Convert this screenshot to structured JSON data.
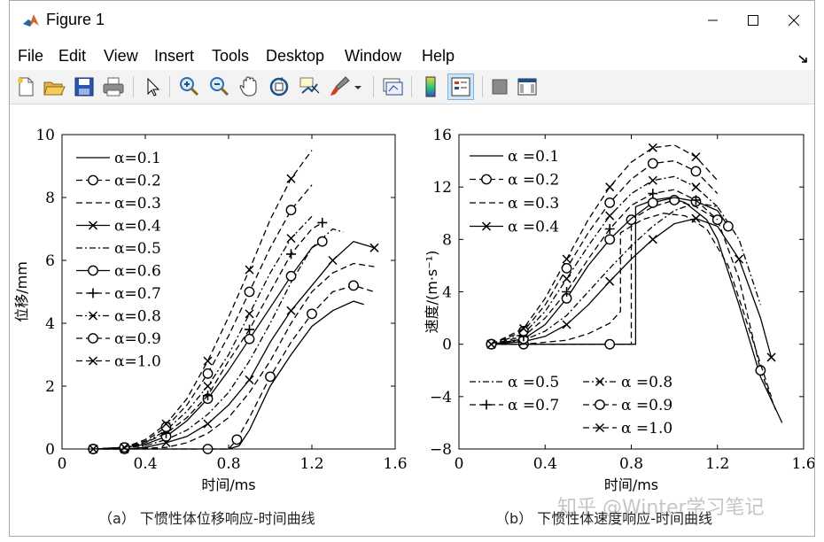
{
  "window": {
    "title": "Figure 1",
    "icons": [
      "matlab-icon",
      "minimize-icon",
      "maximize-icon",
      "close-icon",
      "dock-arrow-icon"
    ]
  },
  "menu": [
    "File",
    "Edit",
    "View",
    "Insert",
    "Tools",
    "Desktop",
    "Window",
    "Help"
  ],
  "toolbar": [
    "new-figure-icon",
    "open-file-icon",
    "save-icon",
    "print-icon",
    "select-arrow-icon",
    "zoom-in-icon",
    "zoom-out-icon",
    "pan-hand-icon",
    "rotate-3d-icon",
    "data-cursor-icon",
    "brush-icon",
    "brush-dropdown-icon",
    "link-plot-icon",
    "colorbar-icon",
    "legend-icon",
    "hide-plot-tools-icon",
    "show-plot-tools-icon"
  ],
  "colors": {
    "line": "#000000",
    "active_tool": "#cce4f7"
  },
  "chart_data": [
    {
      "type": "line",
      "caption": "（a） 下惯性体位移响应-时间曲线",
      "ylabel": "位移/mm",
      "xlabel": "时间/ms",
      "xlim": [
        0,
        1.6
      ],
      "ylim": [
        0,
        10
      ],
      "xticks": [
        0,
        0.4,
        0.8,
        1.2,
        1.6
      ],
      "xtick_labels": [
        "0",
        "0.4",
        "0.8",
        "1.2",
        "1.6"
      ],
      "yticks": [
        0,
        2,
        4,
        6,
        8,
        10
      ],
      "ytick_labels": [
        "0",
        "2",
        "4",
        "6",
        "8",
        "10"
      ],
      "legend_position": "top-left",
      "series": [
        {
          "name": "α=0.1",
          "style": "solid",
          "marker": "none",
          "x": [
            0.15,
            0.3,
            0.5,
            0.7,
            0.8,
            0.85,
            0.9,
            1.0,
            1.1,
            1.2,
            1.3,
            1.4,
            1.45
          ],
          "y": [
            0,
            0,
            0,
            0,
            0,
            0.1,
            0.6,
            2.0,
            3.0,
            3.9,
            4.4,
            4.7,
            4.6
          ]
        },
        {
          "name": "α=0.2",
          "style": "dashed",
          "marker": "o",
          "x": [
            0.15,
            0.3,
            0.5,
            0.7,
            0.8,
            0.84,
            0.9,
            1.0,
            1.1,
            1.2,
            1.3,
            1.4,
            1.5
          ],
          "y": [
            0,
            0,
            0,
            0,
            0,
            0.3,
            1.0,
            2.3,
            3.4,
            4.3,
            5.0,
            5.2,
            5.0
          ]
        },
        {
          "name": "α=0.3",
          "style": "dashed",
          "marker": "none",
          "x": [
            0.15,
            0.3,
            0.5,
            0.6,
            0.7,
            0.8,
            0.9,
            1.0,
            1.1,
            1.2,
            1.3,
            1.4,
            1.5
          ],
          "y": [
            0,
            0,
            0.05,
            0.2,
            0.5,
            1.0,
            1.8,
            2.8,
            4.0,
            5.0,
            5.6,
            5.9,
            5.8
          ]
        },
        {
          "name": "α=0.4",
          "style": "solid",
          "marker": "x",
          "x": [
            0.15,
            0.3,
            0.4,
            0.5,
            0.6,
            0.7,
            0.8,
            0.9,
            1.0,
            1.1,
            1.2,
            1.3,
            1.4,
            1.5
          ],
          "y": [
            0,
            0,
            0.05,
            0.2,
            0.4,
            0.8,
            1.4,
            2.2,
            3.4,
            4.4,
            5.2,
            6.0,
            6.6,
            6.4
          ]
        },
        {
          "name": "α=0.5",
          "style": "dashdot",
          "marker": "none",
          "x": [
            0.15,
            0.3,
            0.4,
            0.5,
            0.6,
            0.7,
            0.8,
            0.9,
            1.0,
            1.1,
            1.2,
            1.3,
            1.35
          ],
          "y": [
            0,
            0.05,
            0.1,
            0.3,
            0.6,
            1.1,
            1.8,
            2.8,
            4.0,
            5.3,
            6.4,
            7.0,
            6.9
          ]
        },
        {
          "name": "α=0.6",
          "style": "solid",
          "marker": "o",
          "x": [
            0.15,
            0.3,
            0.4,
            0.5,
            0.6,
            0.7,
            0.8,
            0.9,
            1.0,
            1.1,
            1.2,
            1.25
          ],
          "y": [
            0,
            0.05,
            0.15,
            0.4,
            0.9,
            1.6,
            2.5,
            3.5,
            4.5,
            5.5,
            6.4,
            6.6
          ]
        },
        {
          "name": "α=0.7",
          "style": "dashed",
          "marker": "+",
          "x": [
            0.15,
            0.3,
            0.4,
            0.5,
            0.6,
            0.7,
            0.8,
            0.9,
            1.0,
            1.1,
            1.2,
            1.25
          ],
          "y": [
            0,
            0.05,
            0.2,
            0.5,
            1.0,
            1.7,
            2.8,
            3.8,
            5.0,
            6.2,
            7.0,
            7.2
          ]
        },
        {
          "name": "α=0.8",
          "style": "dashdot",
          "marker": "x",
          "x": [
            0.15,
            0.3,
            0.4,
            0.5,
            0.6,
            0.7,
            0.8,
            0.9,
            1.0,
            1.1,
            1.2
          ],
          "y": [
            0,
            0.05,
            0.2,
            0.6,
            1.2,
            2.0,
            3.0,
            4.3,
            5.6,
            6.7,
            7.4
          ]
        },
        {
          "name": "α=0.9",
          "style": "dashed",
          "marker": "o",
          "x": [
            0.15,
            0.3,
            0.4,
            0.5,
            0.6,
            0.7,
            0.8,
            0.9,
            1.0,
            1.1,
            1.2
          ],
          "y": [
            0,
            0.05,
            0.25,
            0.7,
            1.4,
            2.4,
            3.6,
            5.0,
            6.4,
            7.6,
            8.4
          ]
        },
        {
          "name": "α=1.0",
          "style": "dashed",
          "marker": "x",
          "x": [
            0.15,
            0.3,
            0.4,
            0.5,
            0.6,
            0.7,
            0.8,
            0.9,
            1.0,
            1.1,
            1.2
          ],
          "y": [
            0,
            0.05,
            0.3,
            0.8,
            1.6,
            2.8,
            4.2,
            5.7,
            7.3,
            8.6,
            9.5
          ]
        }
      ]
    },
    {
      "type": "line",
      "caption": "（b） 下惯性体速度响应-时间曲线",
      "ylabel": "速度/(m·s⁻¹)",
      "xlabel": "时间/ms",
      "xlim": [
        0,
        1.6
      ],
      "ylim": [
        -8,
        16
      ],
      "xticks": [
        0,
        0.4,
        0.8,
        1.2,
        1.6
      ],
      "xtick_labels": [
        "0",
        "0.4",
        "0.8",
        "1.2",
        "1.6"
      ],
      "yticks": [
        -8,
        -4,
        0,
        4,
        8,
        12,
        16
      ],
      "ytick_labels": [
        "−8",
        "−4",
        "0",
        "4",
        "8",
        "12",
        "16"
      ],
      "legend_position": "top-left and bottom-left",
      "series": [
        {
          "name": "α =0.1",
          "style": "solid",
          "marker": "none",
          "x": [
            0.15,
            0.3,
            0.5,
            0.7,
            0.82,
            0.82,
            0.9,
            0.98,
            1.05,
            1.15,
            1.2,
            1.3,
            1.4,
            1.5
          ],
          "y": [
            0,
            0,
            0,
            0,
            0,
            10.5,
            11.0,
            11.2,
            10.8,
            9.5,
            8.0,
            3.0,
            -2.5,
            -6.0
          ]
        },
        {
          "name": "α =0.2",
          "style": "dashed",
          "marker": "o",
          "x": [
            0.15,
            0.3,
            0.5,
            0.7,
            0.8,
            0.8,
            0.9,
            1.0,
            1.1,
            1.2,
            1.3,
            1.4,
            1.47
          ],
          "y": [
            0,
            0,
            0,
            0,
            0,
            9.5,
            10.5,
            11.0,
            10.5,
            9.5,
            5.0,
            -2.0,
            -5.0
          ]
        },
        {
          "name": "α =0.3",
          "style": "dashed",
          "marker": "none",
          "x": [
            0.15,
            0.3,
            0.5,
            0.6,
            0.7,
            0.75,
            0.75,
            0.85,
            0.95,
            1.05,
            1.15,
            1.25,
            1.35,
            1.45
          ],
          "y": [
            0,
            0,
            0.3,
            0.8,
            1.6,
            2.5,
            8.5,
            9.5,
            10.0,
            9.8,
            8.8,
            6.0,
            1.0,
            -4.0
          ]
        },
        {
          "name": "α =0.4",
          "style": "solid",
          "marker": "x",
          "x": [
            0.15,
            0.3,
            0.4,
            0.5,
            0.6,
            0.7,
            0.8,
            0.9,
            1.0,
            1.1,
            1.2,
            1.3,
            1.4,
            1.45
          ],
          "y": [
            0,
            0.2,
            0.6,
            1.5,
            3.0,
            4.8,
            6.5,
            8.0,
            9.2,
            9.6,
            9.0,
            6.5,
            2.0,
            -1.0
          ]
        },
        {
          "name": "α =0.5",
          "style": "dashdot",
          "marker": "none",
          "x": [
            0.15,
            0.3,
            0.4,
            0.5,
            0.6,
            0.7,
            0.8,
            0.9,
            1.0,
            1.1,
            1.2,
            1.3,
            1.4
          ],
          "y": [
            0,
            0.3,
            1.0,
            2.2,
            4.0,
            5.8,
            7.5,
            9.0,
            10.2,
            10.8,
            10.5,
            8.0,
            3.0
          ]
        },
        {
          "name": "α =0.6",
          "style": "solid",
          "marker": "o",
          "x": [
            0.15,
            0.3,
            0.4,
            0.5,
            0.6,
            0.7,
            0.8,
            0.9,
            1.0,
            1.1,
            1.2,
            1.25
          ],
          "y": [
            0,
            0.4,
            1.5,
            3.5,
            6.0,
            8.0,
            9.6,
            10.8,
            11.2,
            10.9,
            10.2,
            9.0
          ]
        },
        {
          "name": "α =0.7",
          "style": "dashed",
          "marker": "+",
          "x": [
            0.15,
            0.3,
            0.4,
            0.5,
            0.6,
            0.7,
            0.8,
            0.9,
            1.0,
            1.1,
            1.2
          ],
          "y": [
            0,
            0.6,
            2.0,
            4.0,
            6.5,
            8.8,
            10.6,
            11.5,
            11.8,
            11.0,
            9.5
          ]
        },
        {
          "name": "α =0.8",
          "style": "dashdot",
          "marker": "x",
          "x": [
            0.15,
            0.3,
            0.4,
            0.5,
            0.6,
            0.7,
            0.8,
            0.9,
            1.0,
            1.1,
            1.2
          ],
          "y": [
            0,
            0.8,
            2.5,
            5.0,
            7.5,
            9.8,
            11.5,
            12.5,
            12.8,
            12.0,
            10.5
          ]
        },
        {
          "name": "α =0.9",
          "style": "dashed",
          "marker": "o",
          "x": [
            0.15,
            0.3,
            0.4,
            0.5,
            0.6,
            0.7,
            0.8,
            0.9,
            1.0,
            1.1,
            1.2
          ],
          "y": [
            0,
            1.0,
            3.0,
            5.8,
            8.5,
            10.8,
            12.6,
            13.8,
            14.0,
            13.2,
            11.5
          ]
        },
        {
          "name": "α =1.0",
          "style": "dashed",
          "marker": "x",
          "x": [
            0.15,
            0.3,
            0.4,
            0.5,
            0.6,
            0.7,
            0.8,
            0.9,
            1.0,
            1.1,
            1.2
          ],
          "y": [
            0,
            1.2,
            3.5,
            6.5,
            9.5,
            12.0,
            13.9,
            15.0,
            15.2,
            14.3,
            12.5
          ]
        }
      ]
    }
  ],
  "watermark": "知乎 @Winter学习笔记"
}
